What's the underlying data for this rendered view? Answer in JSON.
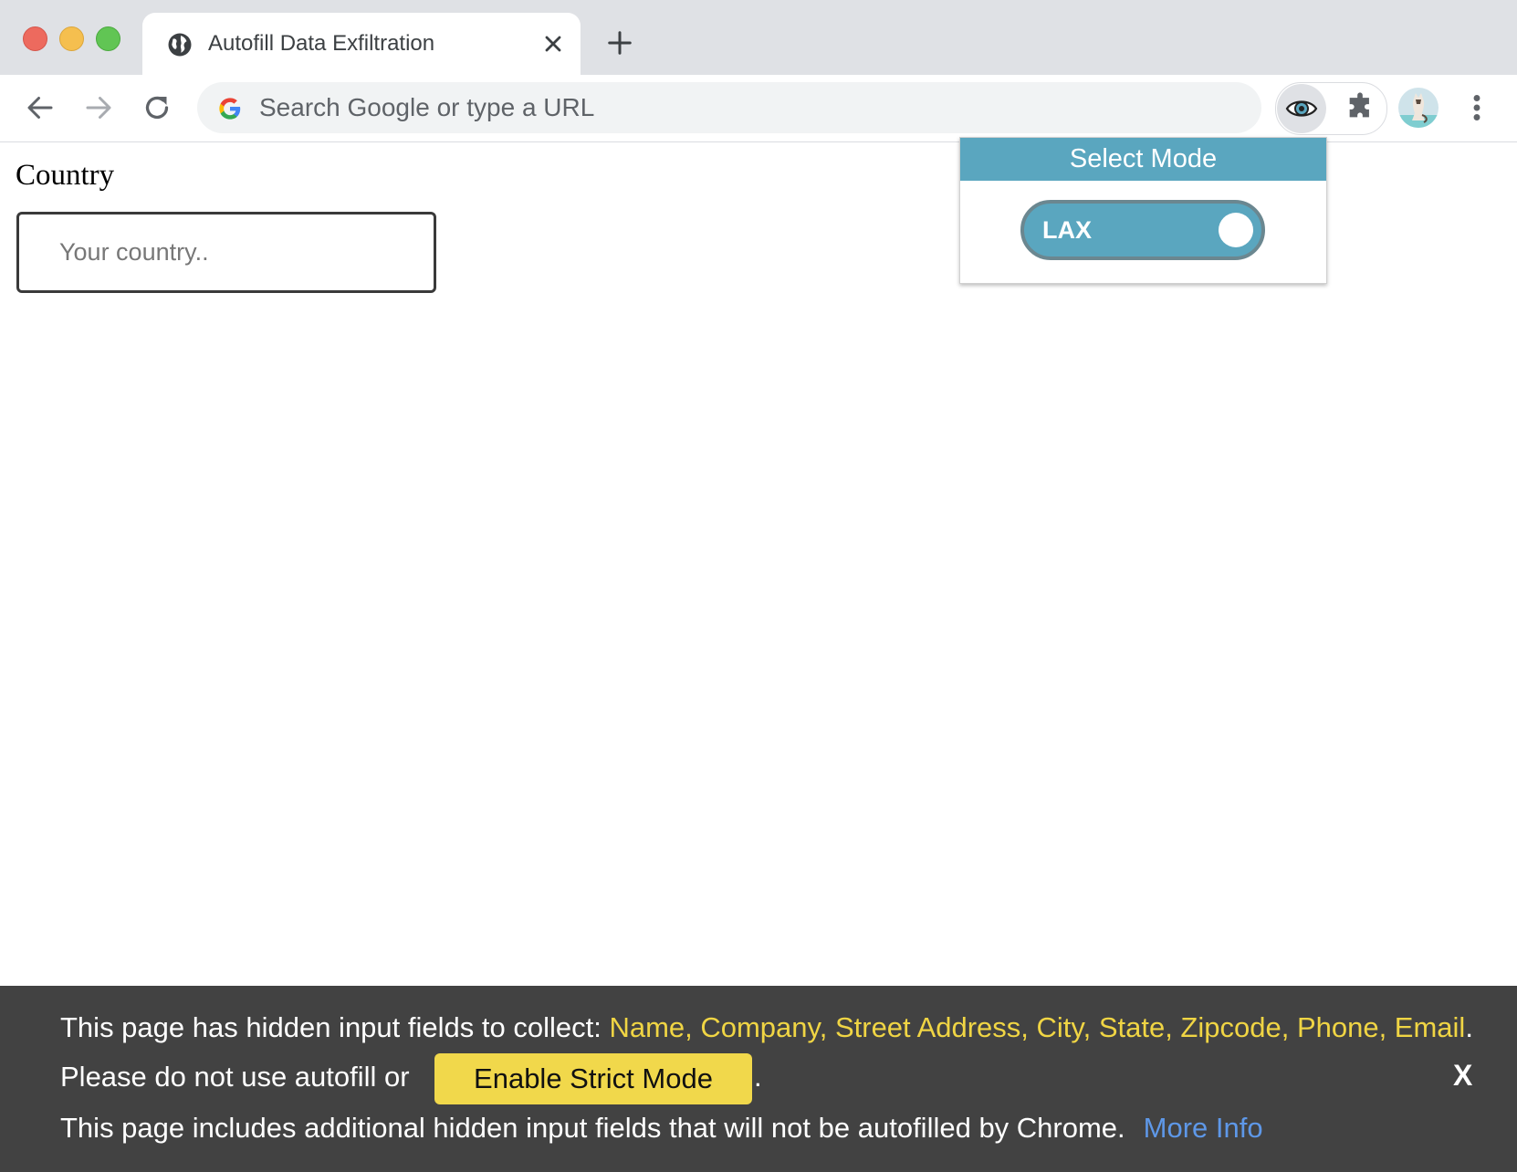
{
  "browser": {
    "tab": {
      "title": "Autofill Data Exfiltration",
      "icon": "globe-icon"
    },
    "omnibox": {
      "placeholder": "Search Google or type a URL"
    }
  },
  "page": {
    "country_label": "Country",
    "country_placeholder": "Your country.."
  },
  "extension_popup": {
    "header": "Select Mode",
    "toggle_label": "LAX",
    "accent_color": "#5aa6bf"
  },
  "notice": {
    "line1_prefix": "This page has hidden input fields to collect: ",
    "line1_fields": "Name, Company, Street Address, City, State, Zipcode, Phone, Email",
    "line1_suffix": ".",
    "line2_prefix": "Please do not use autofill or",
    "strict_button": "Enable Strict Mode",
    "line2_suffix": ".",
    "line3_text": "This page includes additional hidden input fields that will not be autofilled by Chrome.",
    "more_info": "More Info",
    "close": "X",
    "highlight_color": "#f0d544",
    "link_color": "#5e98e8"
  }
}
